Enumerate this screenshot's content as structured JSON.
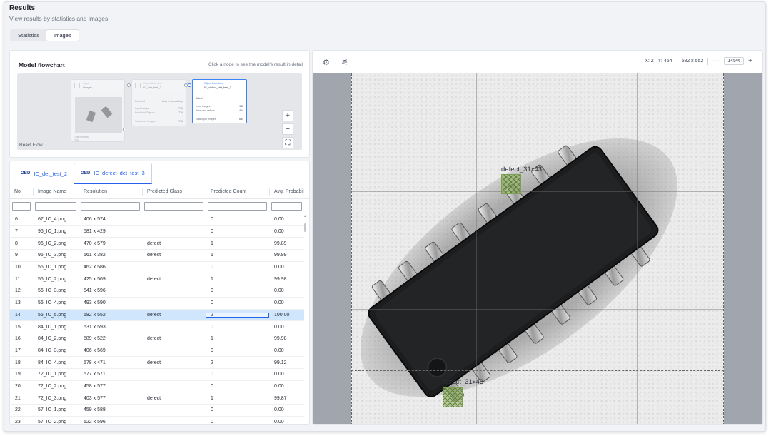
{
  "header": {
    "title": "Results",
    "subtitle": "View results by statistics and images"
  },
  "view_tabs": [
    {
      "label": "Statistics",
      "active": false
    },
    {
      "label": "Images",
      "active": true
    }
  ],
  "flowchart": {
    "title": "Model flowchart",
    "hint": "Click a node to see the model's result in detail",
    "canvas_label": "React Flow",
    "input_node": {
      "type": "Input",
      "name": "Images",
      "footer_label": "Total Images",
      "footer_value": "776"
    },
    "detector_node": {
      "type": "Object Detection",
      "name": "IC_det_test_2",
      "rows": [
        {
          "label": "Detected",
          "value": "Only 1 normal chip"
        },
        {
          "label": "Input Images",
          "value": "776"
        },
        {
          "label": "Predicted Objects",
          "value": "776"
        },
        {
          "label": "Total Input Images",
          "value": "776"
        }
      ]
    },
    "selected_node": {
      "type": "Object Detection",
      "name": "IC_defect_det_test_3",
      "class_label": "defect",
      "rows": [
        {
          "label": "Input Images",
          "value": "143"
        },
        {
          "label": "Predicted defects",
          "value": "404"
        },
        {
          "label": "Total Input Images",
          "value": "684"
        }
      ]
    },
    "controls": [
      "+",
      "−",
      "⛶",
      "⤓"
    ]
  },
  "model_tabs": [
    {
      "badge": "OBD",
      "label": "IC_det_test_2",
      "active": false
    },
    {
      "badge": "OBD",
      "label": "IC_defect_det_test_3",
      "active": true
    }
  ],
  "table": {
    "columns": [
      "No",
      "Image Name",
      "Resolution",
      "Predicted Class",
      "Predicted Count",
      "Avg. Probability"
    ],
    "rows": [
      {
        "no": "6",
        "name": "67_IC_4.png",
        "res": "406 x 574",
        "cls": "",
        "count": "0",
        "prob": "0.00"
      },
      {
        "no": "7",
        "name": "96_IC_1.png",
        "res": "581 x 429",
        "cls": "",
        "count": "0",
        "prob": "0.00"
      },
      {
        "no": "8",
        "name": "96_IC_2.png",
        "res": "470 x 579",
        "cls": "defect",
        "count": "1",
        "prob": "99.89"
      },
      {
        "no": "9",
        "name": "96_IC_3.png",
        "res": "561 x 382",
        "cls": "defect",
        "count": "1",
        "prob": "99.99"
      },
      {
        "no": "10",
        "name": "56_IC_1.png",
        "res": "462 x 586",
        "cls": "",
        "count": "0",
        "prob": "0.00"
      },
      {
        "no": "11",
        "name": "56_IC_2.png",
        "res": "425 x 569",
        "cls": "defect",
        "count": "1",
        "prob": "99.98"
      },
      {
        "no": "12",
        "name": "56_IC_3.png",
        "res": "541 x 596",
        "cls": "",
        "count": "0",
        "prob": "0.00"
      },
      {
        "no": "13",
        "name": "56_IC_4.png",
        "res": "493 x 590",
        "cls": "",
        "count": "0",
        "prob": "0.00"
      },
      {
        "no": "14",
        "name": "56_IC_5.png",
        "res": "582 x 552",
        "cls": "defect",
        "count": "2",
        "prob": "100.00",
        "selected": true
      },
      {
        "no": "15",
        "name": "84_IC_1.png",
        "res": "531 x 593",
        "cls": "",
        "count": "0",
        "prob": "0.00"
      },
      {
        "no": "16",
        "name": "84_IC_2.png",
        "res": "589 x 522",
        "cls": "defect",
        "count": "1",
        "prob": "99.98"
      },
      {
        "no": "17",
        "name": "84_IC_3.png",
        "res": "406 x 569",
        "cls": "",
        "count": "0",
        "prob": "0.00"
      },
      {
        "no": "18",
        "name": "84_IC_4.png",
        "res": "578 x 471",
        "cls": "defect",
        "count": "2",
        "prob": "99.12"
      },
      {
        "no": "19",
        "name": "72_IC_1.png",
        "res": "577 x 571",
        "cls": "",
        "count": "0",
        "prob": "0.00"
      },
      {
        "no": "20",
        "name": "72_IC_2.png",
        "res": "458 x 577",
        "cls": "",
        "count": "0",
        "prob": "0.00"
      },
      {
        "no": "21",
        "name": "72_IC_3.png",
        "res": "403 x 577",
        "cls": "defect",
        "count": "1",
        "prob": "99.87"
      },
      {
        "no": "22",
        "name": "57_IC_1.png",
        "res": "459 x 588",
        "cls": "",
        "count": "0",
        "prob": "0.00"
      },
      {
        "no": "23",
        "name": "57_IC_2.png",
        "res": "522 x 596",
        "cls": "",
        "count": "0",
        "prob": "0.00"
      }
    ]
  },
  "viewer": {
    "cursor_x": "X: 2",
    "cursor_y": "Y: 464",
    "image_size": "582 x 552",
    "zoom": "145%",
    "zoom_out": "—",
    "zoom_in": "+",
    "settings_icon": "gear-icon",
    "adjust_icon": "sliders-icon",
    "detections": [
      {
        "label": "defect_31x43"
      },
      {
        "label": "defect_31x43"
      }
    ]
  },
  "colors": {
    "accent": "#2563eb",
    "selected_row": "#cfe6fc",
    "detection_fill": "#8aaa5a",
    "viewer_bg": "#a1a6ae"
  }
}
